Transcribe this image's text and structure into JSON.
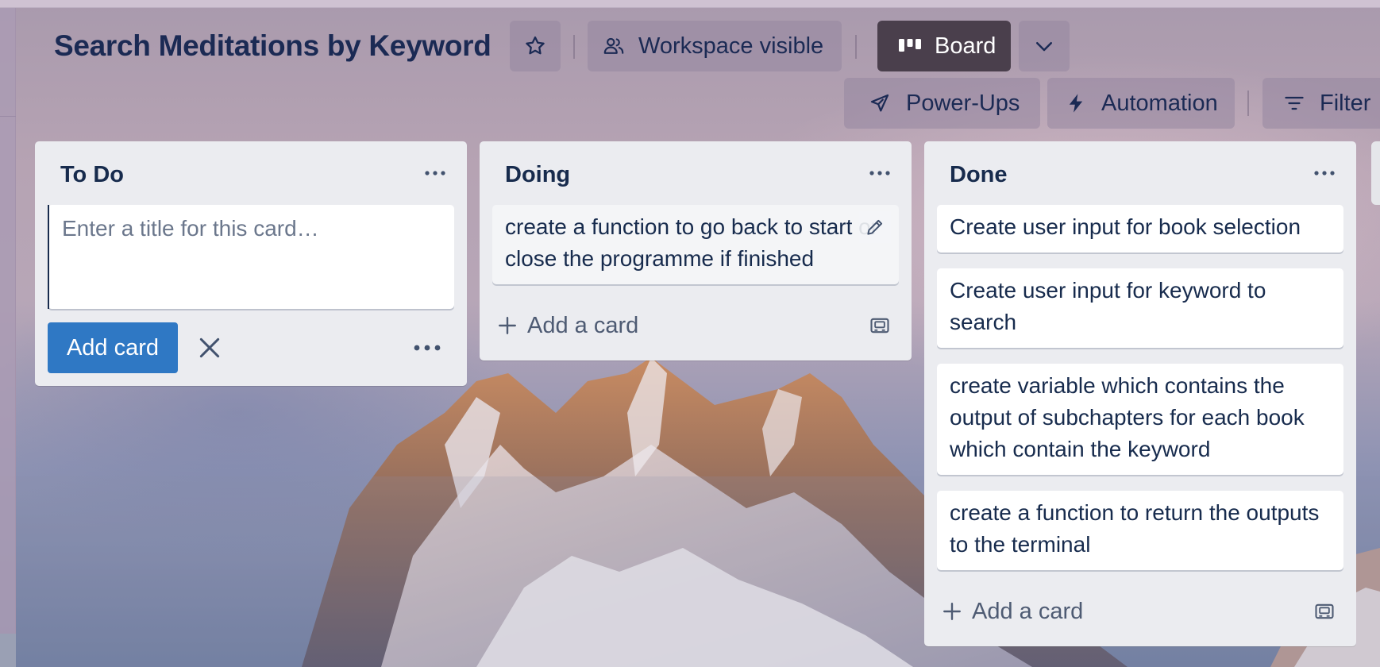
{
  "board": {
    "title": "Search Meditations by Keyword"
  },
  "header": {
    "star_icon": "star-icon",
    "visibility_label": "Workspace visible",
    "view_label": "Board",
    "powerups_label": "Power-Ups",
    "automation_label": "Automation",
    "filter_label": "Filter"
  },
  "lists": [
    {
      "title": "To Do",
      "composer": {
        "placeholder": "Enter a title for this card…",
        "value": "",
        "add_label": "Add card"
      }
    },
    {
      "title": "Doing",
      "cards": [
        "create a function to go back to start or close the programme if finished"
      ],
      "add_label": "Add a card"
    },
    {
      "title": "Done",
      "cards": [
        "Create user input for book selection",
        "Create user input for keyword to search",
        "create variable which contains the output of subchapters for each book which contain the keyword",
        "create a function to return the outputs to the terminal"
      ],
      "add_label": "Add a card"
    }
  ],
  "colors": {
    "title": "#1b2a54",
    "list_bg": "#ebecf0",
    "add_card_button": "#2f78c4",
    "board_button": "#4a3f4c"
  }
}
